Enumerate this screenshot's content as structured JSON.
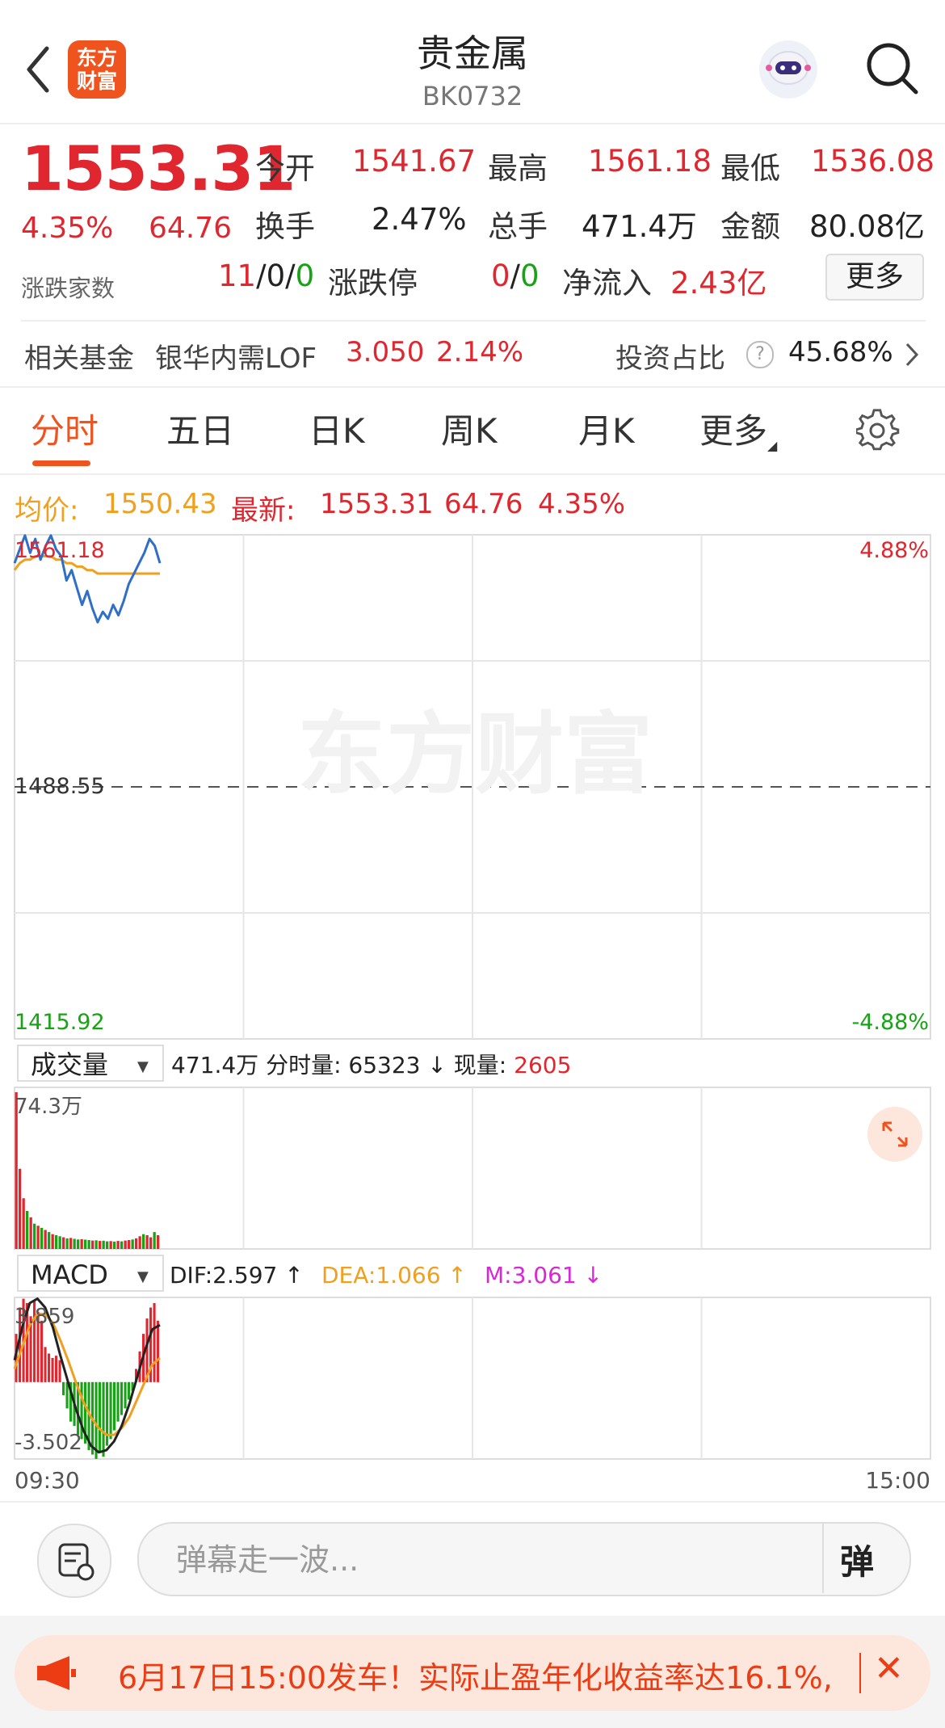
{
  "header": {
    "logo_line1": "东方",
    "logo_line2": "财富",
    "title": "贵金属",
    "code": "BK0732"
  },
  "quote": {
    "price": "1553.31",
    "change_pct": "4.35%",
    "change_amt": "64.76",
    "open_label": "今开",
    "open": "1541.67",
    "high_label": "最高",
    "high": "1561.18",
    "low_label": "最低",
    "low": "1536.08",
    "turnover_label": "换手",
    "turnover": "2.47%",
    "volume_label": "总手",
    "volume": "471.4万",
    "amount_label": "金额",
    "amount": "80.08亿",
    "breadth_label": "涨跌家数",
    "breadth_up": "11",
    "breadth_flat": "0",
    "breadth_down": "0",
    "breadth_sep": "/",
    "limit_label": "涨跌停",
    "limit_up": "0",
    "limit_down": "0",
    "inflow_label": "净流入",
    "inflow": "2.43亿",
    "more_label": "更多"
  },
  "fund": {
    "label": "相关基金",
    "name": "银华内需LOF",
    "price": "3.050",
    "pct": "2.14%",
    "ratio_label": "投资占比",
    "help": "?",
    "ratio": "45.68%"
  },
  "tabs": [
    {
      "label": "分时",
      "active": true
    },
    {
      "label": "五日"
    },
    {
      "label": "日K"
    },
    {
      "label": "周K"
    },
    {
      "label": "月K"
    },
    {
      "label": "更多"
    }
  ],
  "info": {
    "avg_label": "均价:",
    "avg": "1550.43",
    "latest_label": "最新:",
    "latest": "1553.31",
    "latest_amt": "64.76",
    "latest_pct": "4.35%"
  },
  "chart_data": [
    {
      "type": "line",
      "name": "intraday",
      "y_top": "1561.18",
      "y_mid": "1488.55",
      "y_bottom": "1415.92",
      "pct_top": "4.88%",
      "pct_bottom": "-4.88%",
      "ylim": [
        1415.92,
        1561.18
      ],
      "x_start": "09:30",
      "x_end": "15:00",
      "watermark": "东方财富",
      "price": [
        1553,
        1557,
        1561,
        1556,
        1560,
        1554,
        1558,
        1561,
        1557,
        1555,
        1548,
        1551,
        1546,
        1541,
        1545,
        1540,
        1536,
        1539,
        1537,
        1541,
        1538,
        1542,
        1547,
        1550,
        1553,
        1556,
        1560,
        1558,
        1553
      ],
      "avg": [
        1551,
        1553,
        1554,
        1554,
        1555,
        1555,
        1555,
        1555,
        1554,
        1554,
        1553,
        1553,
        1552,
        1552,
        1551,
        1551,
        1550,
        1550,
        1550,
        1550,
        1550,
        1550,
        1550,
        1550,
        1550,
        1550,
        1550,
        1550,
        1550
      ],
      "series_colors": {
        "price": "#2f6fc7",
        "avg": "#f0a01e"
      }
    },
    {
      "type": "bar",
      "name": "volume",
      "selector_label": "成交量",
      "total": "471.4万",
      "minute_label": "分时量:",
      "minute_vol": "65323",
      "minute_arrow": "↓",
      "now_label": "现量:",
      "now_vol": "2605",
      "ymax_label": "74.3万",
      "ymax": 743000,
      "values": [
        743000,
        380000,
        240000,
        180000,
        150000,
        120000,
        110000,
        100000,
        90000,
        80000,
        70000,
        65000,
        60000,
        55000,
        50000,
        52000,
        48000,
        45000,
        46000,
        44000,
        42000,
        40000,
        41000,
        38000,
        39000,
        36000,
        37000,
        35000,
        38000,
        36000,
        40000,
        42000,
        45000,
        50000,
        60000,
        70000,
        65000,
        55000,
        80000,
        65000
      ],
      "up": [
        true,
        true,
        true,
        false,
        true,
        false,
        true,
        false,
        true,
        false,
        true,
        false,
        false,
        true,
        false,
        true,
        false,
        false,
        true,
        false,
        false,
        true,
        false,
        true,
        false,
        false,
        true,
        false,
        true,
        false,
        true,
        true,
        false,
        true,
        true,
        false,
        true,
        true,
        false,
        true
      ]
    },
    {
      "type": "bar",
      "name": "MACD",
      "selector_label": "MACD",
      "dif_label": "DIF:2.597 ↑",
      "dea_label": "DEA:1.066 ↑",
      "m_label": "M:3.061 ↓",
      "ymax_label": "3.859",
      "ymin_label": "-3.502",
      "ylim": [
        -3.502,
        3.859
      ],
      "hist": [
        2.2,
        3.4,
        3.8,
        3.6,
        3.0,
        3.7,
        3.2,
        2.8,
        1.6,
        1.3,
        1.1,
        1.2,
        1.0,
        -0.6,
        -1.2,
        -1.8,
        -2.0,
        -2.4,
        -2.6,
        -2.8,
        -3.1,
        -3.3,
        -3.5,
        -3.2,
        -3.4,
        -2.9,
        -2.6,
        -2.2,
        -1.8,
        -1.5,
        -1.2,
        -0.8,
        -0.4,
        0.6,
        1.4,
        2.2,
        2.9,
        3.4,
        3.6,
        2.8
      ],
      "dif": [
        1.0,
        2.5,
        3.6,
        3.8,
        3.4,
        2.5,
        1.2,
        0.0,
        -1.2,
        -2.2,
        -2.9,
        -3.2,
        -3.1,
        -2.7,
        -2.0,
        -1.0,
        0.2,
        1.4,
        2.4,
        2.6
      ],
      "dea": [
        0.6,
        1.6,
        2.6,
        3.1,
        3.1,
        2.7,
        1.9,
        1.0,
        0.0,
        -0.9,
        -1.6,
        -2.1,
        -2.4,
        -2.4,
        -2.1,
        -1.6,
        -0.8,
        0.0,
        0.8,
        1.1
      ],
      "colors": {
        "dif": "#222222",
        "dea": "#f0a01e",
        "up": "#e0262e",
        "down": "#18a316"
      }
    }
  ],
  "comment": {
    "placeholder": "弹幕走一波...",
    "danmu_label": "弹"
  },
  "promo": {
    "text": "6月17日15:00发车！实际止盈年化收益率达16.1%,",
    "close": "✕"
  },
  "colors": {
    "up": "#e0262e",
    "down": "#18a316",
    "accent": "#f0541e",
    "avg": "#f0a01e"
  }
}
